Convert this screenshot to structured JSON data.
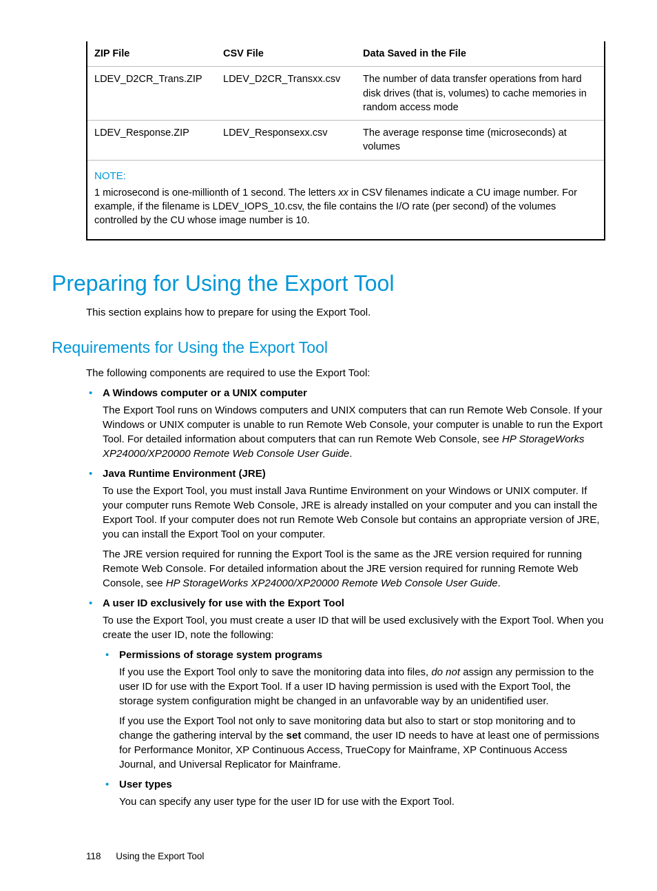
{
  "table": {
    "headers": [
      "ZIP File",
      "CSV File",
      "Data Saved in the File"
    ],
    "rows": [
      {
        "zip": "LDEV_D2CR_Trans.ZIP",
        "csv": "LDEV_D2CR_Transxx.csv",
        "desc": "The number of data transfer operations from hard disk drives (that is, volumes) to cache memories in random access mode"
      },
      {
        "zip": "LDEV_Response.ZIP",
        "csv": "LDEV_Responsexx.csv",
        "desc": "The average response time (microseconds) at volumes"
      }
    ],
    "note_label": "NOTE:",
    "note_pre": "1 microsecond is one-millionth of 1 second. The letters ",
    "note_xx": "xx",
    "note_post": " in CSV filenames indicate a CU image number. For example, if the filename is LDEV_IOPS_10.csv, the file contains the I/O rate (per second) of the volumes controlled by the CU whose image number is 10."
  },
  "h1": "Preparing for Using the Export Tool",
  "h1_intro": "This section explains how to prepare for using the Export Tool.",
  "h2": "Requirements for Using the Export Tool",
  "h2_intro": "The following components are required to use the Export Tool:",
  "req1_title": "A Windows computer or a UNIX computer",
  "req1_p_a": "The Export Tool runs on Windows computers and UNIX computers that can run Remote Web Console. If your Windows or UNIX computer is unable to run Remote Web Console, your computer is unable to run the Export Tool. For detailed information about computers that can run Remote Web Console, see ",
  "req1_p_b": "HP StorageWorks XP24000/XP20000 Remote Web Console User Guide",
  "req1_p_c": ".",
  "req2_title": "Java Runtime Environment (JRE)",
  "req2_p1": "To use the Export Tool, you must install Java Runtime Environment on your Windows or UNIX computer. If your computer runs Remote Web Console, JRE is already installed on your computer and you can install the Export Tool. If your computer does not run Remote Web Console but contains an appropriate version of JRE, you can install the Export Tool on your computer.",
  "req2_p2_a": "The JRE version required for running the Export Tool is the same as the JRE version required for running Remote Web Console. For detailed information about the JRE version required for running Remote Web Console, see ",
  "req2_p2_b": "HP StorageWorks XP24000/XP20000 Remote Web Console User Guide",
  "req2_p2_c": ".",
  "req3_title": "A user ID exclusively for use with the Export Tool",
  "req3_p1": "To use the Export Tool, you must create a user ID that will be used exclusively with the Export Tool. When you create the user ID, note the following:",
  "req3_sub1_title": "Permissions of storage system programs",
  "req3_sub1_p1_a": "If you use the Export Tool only to save the monitoring data into files, ",
  "req3_sub1_p1_b": "do not",
  "req3_sub1_p1_c": " assign any permission to the user ID for use with the Export Tool. If a user ID having permission is used with the Export Tool, the storage system configuration might be changed in an unfavorable way by an unidentified user.",
  "req3_sub1_p2_a": "If you use the Export Tool not only to save monitoring data but also to start or stop monitoring and to change the gathering interval by the ",
  "req3_sub1_p2_b": "set",
  "req3_sub1_p2_c": " command, the user ID needs to have at least one of permissions for Performance Monitor, XP Continuous Access, TrueCopy for Mainframe, XP Continuous Access Journal, and Universal Replicator for Mainframe.",
  "req3_sub2_title": "User types",
  "req3_sub2_p1": "You can specify any user type for the user ID for use with the Export Tool.",
  "footer_page": "118",
  "footer_title": "Using the Export Tool"
}
